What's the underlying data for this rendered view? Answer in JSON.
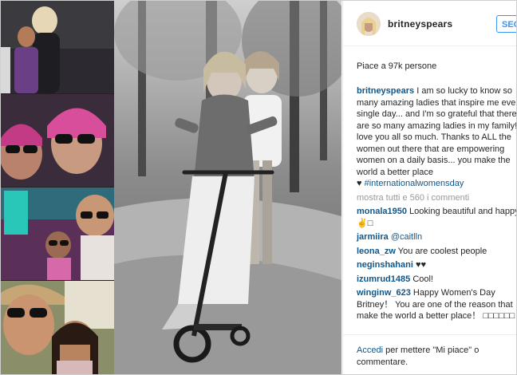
{
  "post": {
    "username": "britneyspears",
    "follow_label": "SEG",
    "likes_text": "Piace a 97k persone",
    "caption_user": "britneyspears",
    "caption_text": "I am so lucky to know so many amazing ladies that inspire me every single day... and I'm so grateful that there are so many amazing ladies in my family! I love you all so much. Thanks to ALL the women out there that are empowering women on a daily basis... you make the world a better place",
    "caption_heart": "♥",
    "caption_tag": "#internationalwomensday",
    "view_all": "mostra tutti e 560 i commenti"
  },
  "comments": [
    {
      "user": "monala1950",
      "text": "Looking beautiful and happy♥✌□"
    },
    {
      "user": "jarmiira",
      "text": "@caitlln"
    },
    {
      "user": "leona_zw",
      "text": "You are coolest people"
    },
    {
      "user": "neginshahani",
      "text": "♥♥"
    },
    {
      "user": "izumrud1485",
      "text": "Cool!"
    },
    {
      "user": "winginw_623",
      "text": "Happy Women's Day Britney！ You are one of the reason that make the world a better place！ □□□□□□"
    }
  ],
  "footer": {
    "login_link": "Accedi",
    "login_text": " per mettere \"Mi piace\" o commentare."
  },
  "icons": {
    "avatar": "profile-avatar",
    "heart": "heart-icon"
  }
}
